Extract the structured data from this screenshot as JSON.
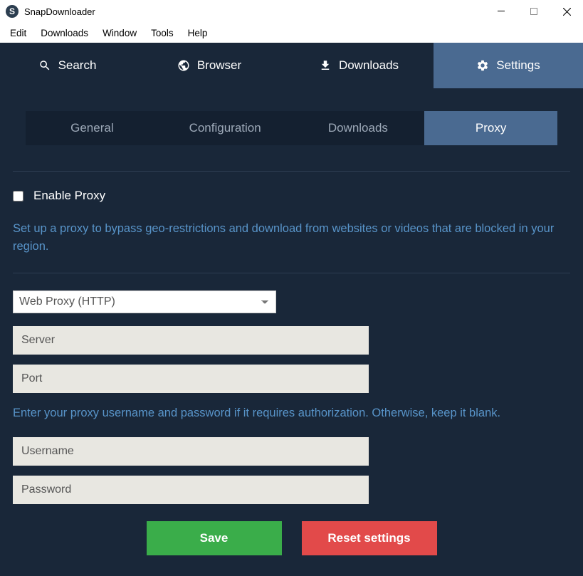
{
  "app": {
    "title": "SnapDownloader"
  },
  "menubar": [
    "Edit",
    "Downloads",
    "Window",
    "Tools",
    "Help"
  ],
  "main_tabs": {
    "search": "Search",
    "browser": "Browser",
    "downloads": "Downloads",
    "settings": "Settings"
  },
  "sub_tabs": {
    "general": "General",
    "configuration": "Configuration",
    "downloads": "Downloads",
    "proxy": "Proxy"
  },
  "proxy": {
    "enable_label": "Enable Proxy",
    "description": "Set up a proxy to bypass geo-restrictions and download from websites or videos that are blocked in your region.",
    "type_selected": "Web Proxy (HTTP)",
    "server_placeholder": "Server",
    "port_placeholder": "Port",
    "auth_help": "Enter your proxy username and password if it requires authorization. Otherwise, keep it blank.",
    "username_placeholder": "Username",
    "password_placeholder": "Password"
  },
  "buttons": {
    "save": "Save",
    "reset": "Reset settings"
  }
}
